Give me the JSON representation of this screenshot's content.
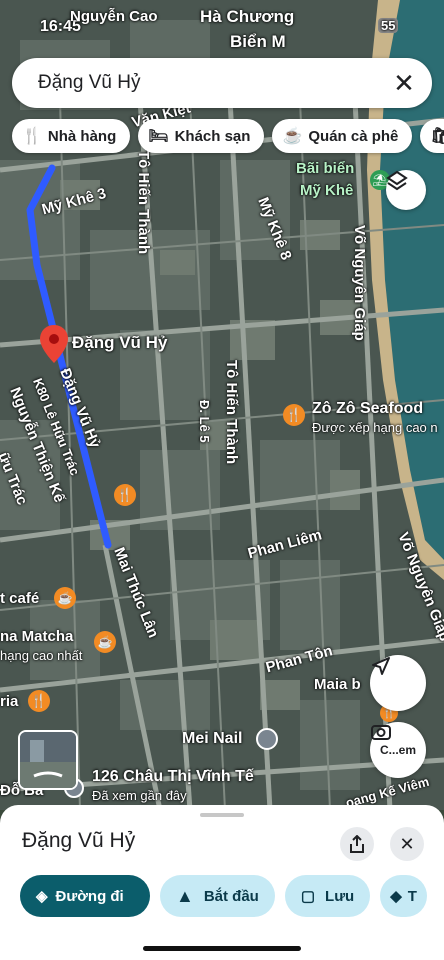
{
  "status_bar": {
    "time": "16:45",
    "battery": "55"
  },
  "search": {
    "query": "Đặng Vũ Hỷ",
    "clear_icon": "close-icon"
  },
  "chips": [
    {
      "icon": "fork-knife-icon",
      "label": "Nhà hàng"
    },
    {
      "icon": "bed-icon",
      "label": "Khách sạn"
    },
    {
      "icon": "coffee-cup-icon",
      "label": "Quán cà phê"
    }
  ],
  "map_labels": {
    "top_street_1": "Nguyễn Cao",
    "top_street_2": "Hà Chương",
    "top_street_3": "Biển M",
    "street_nam_ky": "Văn Kiệt",
    "beach_1": "Bãi biển",
    "beach_2": "Mỹ Khê",
    "my_khe_3": "Mỹ Khê 3",
    "to_hien_thanh_1": "Tô Hiến Thành",
    "my_khe_8": "Mỹ Khê 8",
    "vo_nguyen_giap_1": "Võ Nguyên Giáp",
    "selected_place": "Đặng Vũ Hỷ",
    "dang_vu_hy_street": "Đặng Vũ Hỷ",
    "k80": "K80 Lê Hữu Trác",
    "nguyen_thien_ke": "Nguyễn Thiện Kế",
    "huu_trac": "ữu Trác",
    "to_hien_thanh_2": "Tô Hiến Thành",
    "le_street": "Đ. Lê 5",
    "zo_zo_name": "Zô Zô Seafood",
    "zo_zo_sub": "Được xếp hạng cao n",
    "phan_liem": "Phan Liêm",
    "mai_thuc_lan": "Mai Thúc Lân",
    "vo_nguyen_giap_2": "Võ Nguyên Giáp",
    "cafe": "t café",
    "matcha": "na Matcha",
    "matcha_sub": "hạng cao nhất",
    "phan_ton": "Phan Tôn",
    "maia": "Maia b",
    "ria": "ria",
    "mei_nail": "Mei Nail",
    "chau_thi": "126 Châu Thị Vĩnh Tế",
    "chau_thi_sub": "Đã xem gần đây",
    "do_ba": "Đỗ Bá",
    "hoang_ke": "oang Kế Viêm"
  },
  "map_controls": {
    "layers_icon": "layers-icon",
    "locate_icon": "navigation-arrow-icon",
    "camera_icon": "camera-search-icon",
    "camera_label": "C...em"
  },
  "sheet": {
    "title": "Đặng Vũ Hỷ",
    "share_icon": "share-icon",
    "close_icon": "close-icon",
    "actions": [
      {
        "icon": "directions-icon",
        "label": "Đường đi"
      },
      {
        "icon": "navigation-icon",
        "label": "Bắt đầu"
      },
      {
        "icon": "bookmark-icon",
        "label": "Lưu"
      },
      {
        "icon": "label-icon",
        "label": "T"
      }
    ]
  },
  "colors": {
    "route": "#2f5bff",
    "pin": "#ea4335",
    "poi": "#f28b24",
    "primary": "#0b5d6b",
    "secondary": "#c6eaf5"
  }
}
